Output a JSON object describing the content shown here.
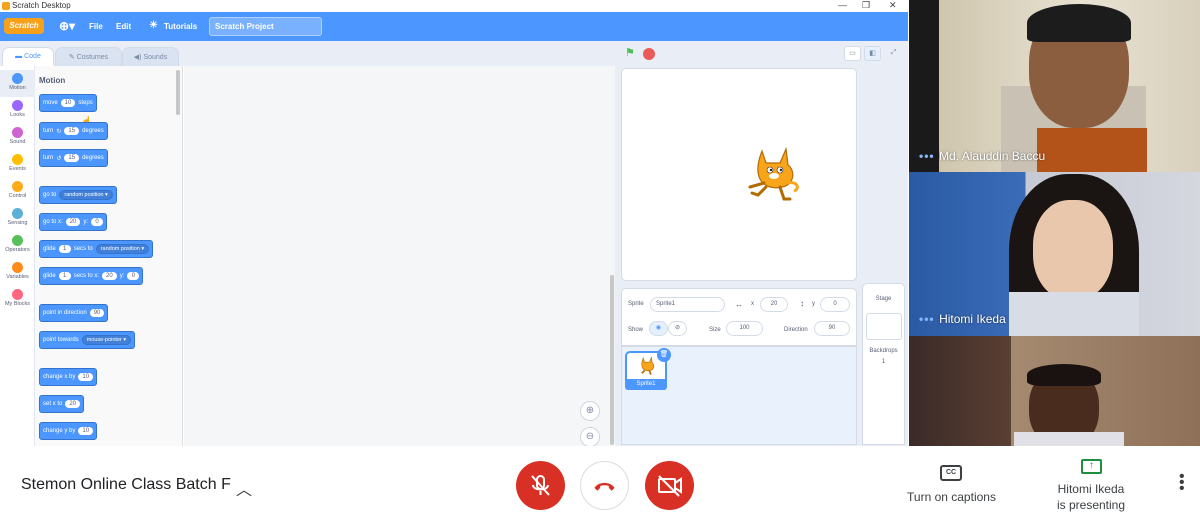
{
  "app": {
    "window_title": "Scratch Desktop"
  },
  "menu": {
    "logo": "Scratch",
    "file": "File",
    "edit": "Edit",
    "tutorials": "Tutorials",
    "project_title": "Scratch Project"
  },
  "tabs": {
    "code": "Code",
    "costumes": "Costumes",
    "sounds": "Sounds"
  },
  "categories": [
    {
      "label": "Motion",
      "color": "#4c97ff"
    },
    {
      "label": "Looks",
      "color": "#9966ff"
    },
    {
      "label": "Sound",
      "color": "#cf63cf"
    },
    {
      "label": "Events",
      "color": "#ffbf00"
    },
    {
      "label": "Control",
      "color": "#ffab19"
    },
    {
      "label": "Sensing",
      "color": "#5cb1d6"
    },
    {
      "label": "Operators",
      "color": "#59c059"
    },
    {
      "label": "Variables",
      "color": "#ff8c1a"
    },
    {
      "label": "My Blocks",
      "color": "#ff6680"
    }
  ],
  "palette": {
    "heading": "Motion",
    "move": {
      "a": "move",
      "v": "10",
      "b": "steps"
    },
    "turn_right": {
      "a": "turn",
      "v": "15",
      "b": "degrees"
    },
    "turn_left": {
      "a": "turn",
      "v": "15",
      "b": "degrees"
    },
    "goto": {
      "a": "go to",
      "opt": "random position"
    },
    "gotoxy": {
      "a": "go to x:",
      "x": "20",
      "b": "y:",
      "y": "0"
    },
    "glide_to": {
      "a": "glide",
      "v": "1",
      "b": "secs to",
      "opt": "random position"
    },
    "glide_xy": {
      "a": "glide",
      "v": "1",
      "b": "secs to x:",
      "x": "20",
      "c": "y:",
      "y": "0"
    },
    "point_dir": {
      "a": "point in direction",
      "v": "90"
    },
    "point_towards": {
      "a": "point towards",
      "opt": "mouse-pointer"
    },
    "change_x": {
      "a": "change x by",
      "v": "10"
    },
    "set_x": {
      "a": "set x to",
      "v": "20"
    },
    "change_y": {
      "a": "change y by",
      "v": "10"
    }
  },
  "sprite_info": {
    "sprite_label": "Sprite",
    "sprite_name": "Sprite1",
    "x_label": "x",
    "x": "20",
    "y_label": "y",
    "y": "0",
    "show_label": "Show",
    "size_label": "Size",
    "size": "100",
    "direction_label": "Direction",
    "direction": "90"
  },
  "sprite_list": [
    {
      "name": "Sprite1"
    }
  ],
  "stage_panel": {
    "title": "Stage",
    "backdrops_label": "Backdrops",
    "backdrops_count": "1"
  },
  "participants": [
    {
      "name": "Md. Alauddin Baccu"
    },
    {
      "name": "Hitomi Ikeda"
    },
    {
      "name": ""
    }
  ],
  "meeting": {
    "name": "Stemon Online Class Batch F",
    "captions_label": "Turn on captions",
    "presenter_line1": "Hitomi Ikeda",
    "presenter_line2": "is presenting"
  },
  "colors": {
    "scratch_blue": "#4c97ff",
    "meet_red": "#d93025",
    "presenting_green": "#1e8e3e"
  }
}
